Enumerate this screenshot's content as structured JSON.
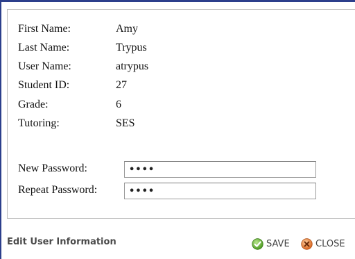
{
  "user_info": [
    {
      "label": "First Name:",
      "value": "Amy"
    },
    {
      "label": "Last Name:",
      "value": "Trypus"
    },
    {
      "label": "User Name:",
      "value": "atrypus"
    },
    {
      "label": "Student ID:",
      "value": "27"
    },
    {
      "label": "Grade:",
      "value": "6"
    },
    {
      "label": "Tutoring:",
      "value": "SES"
    }
  ],
  "password": {
    "new_label": "New Password:",
    "new_value": "••••",
    "repeat_label": "Repeat Password:",
    "repeat_value": "••••"
  },
  "footer": {
    "title": "Edit User Information",
    "save_label": "SAVE",
    "close_label": "CLOSE",
    "save_icon": "checkmark-icon",
    "close_icon": "close-icon"
  },
  "colors": {
    "frame_border": "#2c3f8c",
    "save_icon": "#5fae2e",
    "close_icon": "#e0742a"
  }
}
